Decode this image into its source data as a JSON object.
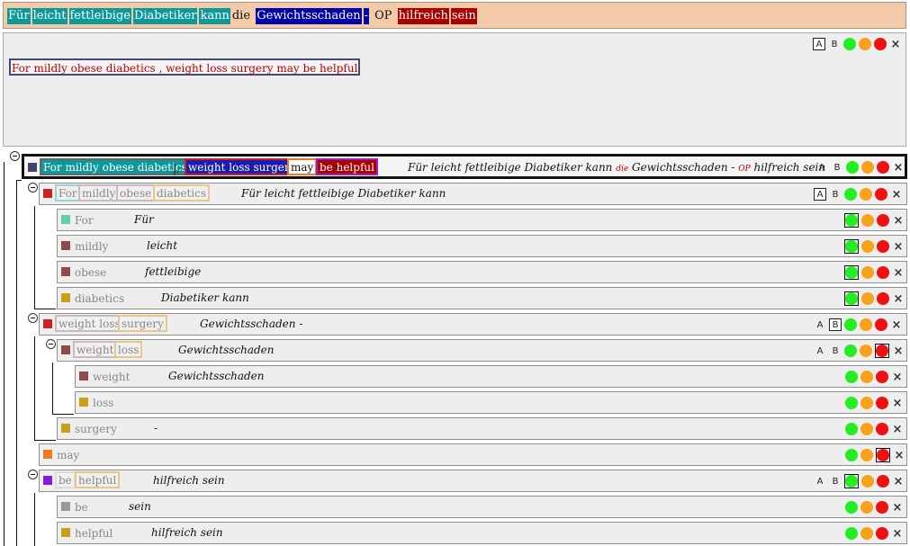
{
  "header": {
    "tokens": [
      {
        "text": "Für",
        "color": "#0d9999"
      },
      {
        "text": "leicht",
        "color": "#0d9999"
      },
      {
        "text": "fettleibige",
        "color": "#0d9999"
      },
      {
        "text": "Diabetiker",
        "color": "#0d9999"
      },
      {
        "text": "kann",
        "color": "#0d9999"
      },
      {
        "text": "die",
        "color": "plain"
      },
      {
        "text": "Gewichtsschaden",
        "color": "#0000aa"
      },
      {
        "text": "-",
        "color": "#0000aa"
      },
      {
        "text": "OP",
        "color": "plain"
      },
      {
        "text": "hilfreich",
        "color": "#aa0000"
      },
      {
        "text": "sein",
        "color": "#aa0000"
      }
    ]
  },
  "source": {
    "sentence": "For mildly obese diabetics , weight loss surgery may be helpful",
    "ctrl_a": "A",
    "ctrl_b": "B"
  },
  "tree": {
    "root": {
      "chunks": [
        {
          "text": "For mildly obese diabetics",
          "bg": "#0d9999",
          "border": "#666",
          "color": "#ffffff"
        },
        {
          "text": "weight loss surgery",
          "bg": "#1c1cb0",
          "border": "#cc2222",
          "color": "#ffffff"
        },
        {
          "text": "may",
          "bg": "#ffffff",
          "border": "#ef7a22",
          "color": "#111111"
        },
        {
          "text": "be helpful",
          "bg": "#aa0000",
          "border": "#9a20cc",
          "color": "#ffffff"
        }
      ],
      "comma": "|,",
      "translation_parts": [
        "Für leicht fettleibige Diabetiker kann",
        "die",
        "Gewichtsschaden -",
        "OP",
        "hilfreich sein"
      ]
    },
    "rows": [
      {
        "id": "for-mildly-obese-diabetics",
        "chips": [
          "For",
          "mildly",
          "obese",
          "diabetics"
        ],
        "translation": "Für leicht fettleibige Diabetiker kann"
      },
      {
        "id": "for",
        "label": "For",
        "translation": "Für"
      },
      {
        "id": "mildly",
        "label": "mildly",
        "translation": "leicht"
      },
      {
        "id": "obese",
        "label": "obese",
        "translation": "fettleibige"
      },
      {
        "id": "diabetics",
        "label": "diabetics",
        "translation": "Diabetiker kann"
      },
      {
        "id": "weight-loss-surgery",
        "chips": [
          "weight loss",
          "surgery"
        ],
        "translation": "Gewichtsschaden -"
      },
      {
        "id": "weight-loss",
        "chips": [
          "weight",
          "loss"
        ],
        "translation": "Gewichtsschaden"
      },
      {
        "id": "weight",
        "label": "weight",
        "translation": "Gewichtsschaden"
      },
      {
        "id": "loss",
        "label": "loss",
        "translation": ""
      },
      {
        "id": "surgery",
        "label": "surgery",
        "translation": "-"
      },
      {
        "id": "may",
        "label": "may",
        "translation": ""
      },
      {
        "id": "be-helpful",
        "chips": [
          "be",
          "helpful"
        ],
        "translation": "hilfreich sein"
      },
      {
        "id": "be",
        "label": "be",
        "translation": "sein"
      },
      {
        "id": "helpful",
        "label": "helpful",
        "translation": "hilfreich sein"
      }
    ],
    "controls": {
      "a": "A",
      "b": "B",
      "close": "×"
    }
  }
}
